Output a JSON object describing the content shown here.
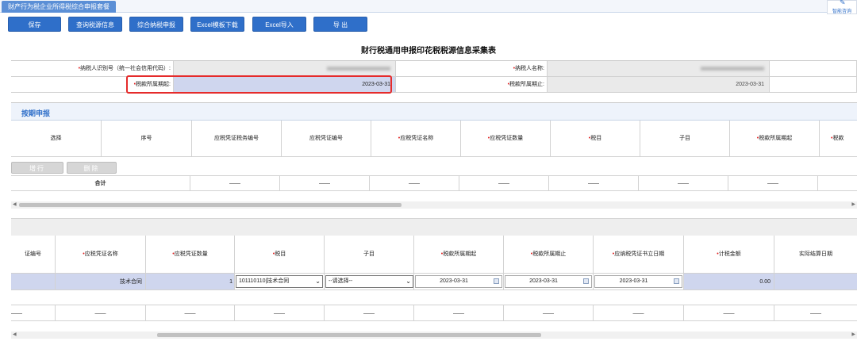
{
  "tab": {
    "title": "财产行为税企业所得税综合申报套餐"
  },
  "help": {
    "label": "智能咨询"
  },
  "toolbar": {
    "save": "保存",
    "query": "查询税源信息",
    "comprehensive": "综合纳税申报",
    "excel_template": "Excel模板下载",
    "excel_import": "Excel导入",
    "export": "导 出"
  },
  "page": {
    "title": "财行税通用申报印花税税源信息采集表"
  },
  "info": {
    "taxpayer_id_label": "纳税人识别号（统一社会信用代码）:",
    "taxpayer_name_label": "纳税人名称:",
    "period_start_label": "税款所属期起:",
    "period_start_value": "2023-03-31",
    "period_end_label": "税款所属期止:",
    "period_end_value": "2023-03-31"
  },
  "section1": {
    "title": "按期申报",
    "columns": [
      "选择",
      "序号",
      "应税凭证税务编号",
      "应税凭证编号",
      "应税凭证名称",
      "应税凭证数量",
      "税目",
      "子目",
      "税款所属期起",
      "税款"
    ],
    "required": [
      false,
      false,
      false,
      false,
      true,
      true,
      true,
      false,
      true,
      true
    ],
    "add_row": "增行",
    "delete": "删除",
    "total_label": "合计",
    "dash": "——"
  },
  "section2": {
    "columns": [
      "证编号",
      "应税凭证名称",
      "应税凭证数量",
      "税目",
      "子目",
      "税款所属期起",
      "税款所属期止",
      "应纳税凭证书立日期",
      "计税金额",
      "实际结算日期"
    ],
    "required": [
      false,
      true,
      true,
      true,
      false,
      true,
      true,
      true,
      true,
      false
    ],
    "row": {
      "name": "技术合同",
      "quantity": "1",
      "tax_item": "101110110|技术合同",
      "sub_item": "--请选择--",
      "period_start": "2023-03-31",
      "period_end": "2023-03-31",
      "sign_date": "2023-03-31",
      "amount": "0.00"
    },
    "dash": "——"
  }
}
